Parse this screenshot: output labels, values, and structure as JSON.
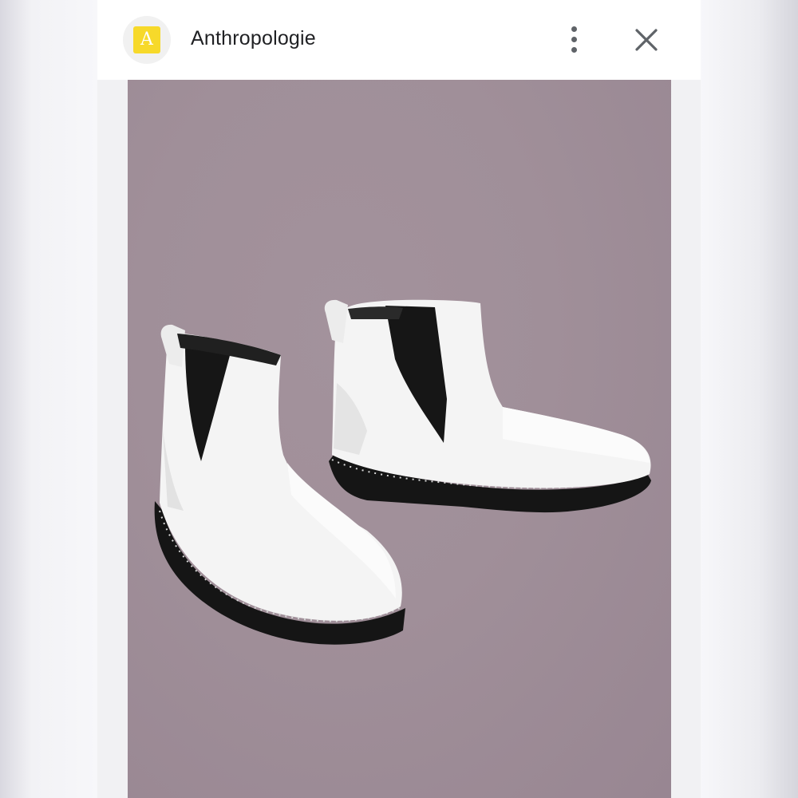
{
  "site": {
    "favicon_letter": "A",
    "title": "Anthropologie"
  },
  "colors": {
    "favicon_bg": "#f7d92a",
    "image_bg": "#a08f99",
    "boot_leather": "#f4f4f4",
    "sole": "#151515"
  },
  "icons": {
    "menu": "more-vert-icon",
    "close": "close-icon"
  }
}
